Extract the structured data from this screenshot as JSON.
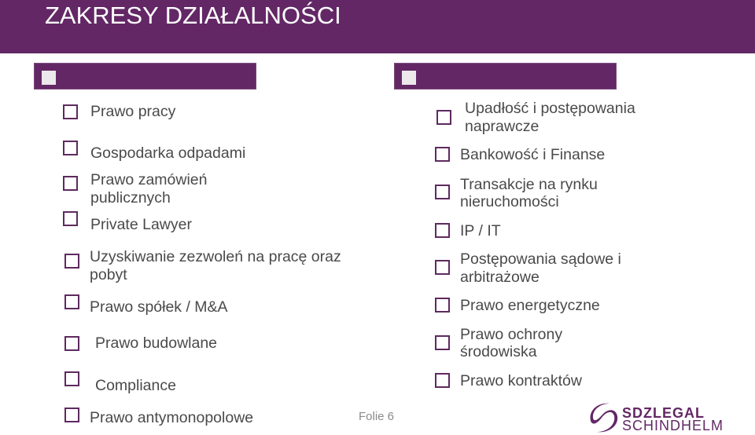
{
  "slide": {
    "title": "ZAKRESY DZIAŁALNOŚCI",
    "footer_label": "Folie 6",
    "colors": {
      "brand": "#632766",
      "text": "#4a4a4a",
      "checkbox_border": "#5e2a5f"
    }
  },
  "left_column": {
    "items": [
      {
        "label_line1": "Prawo pracy",
        "label_line2": ""
      },
      {
        "label_line1": "Gospodarka odpadami",
        "label_line2": ""
      },
      {
        "label_line1": "Prawo zamówień",
        "label_line2": "publicznych"
      },
      {
        "label_line1": "Private Lawyer",
        "label_line2": ""
      },
      {
        "label_line1": "Uzyskiwanie zezwoleń na pracę oraz",
        "label_line2": "pobyt"
      },
      {
        "label_line1": "Prawo spółek / M&A",
        "label_line2": ""
      },
      {
        "label_line1": "Prawo budowlane",
        "label_line2": ""
      },
      {
        "label_line1": "Compliance",
        "label_line2": ""
      },
      {
        "label_line1": "Prawo antymonopolowe",
        "label_line2": ""
      }
    ]
  },
  "right_column": {
    "items": [
      {
        "label_line1": "Upadłość i postępowania",
        "label_line2": "naprawcze"
      },
      {
        "label_line1": "Bankowość i Finanse",
        "label_line2": ""
      },
      {
        "label_line1": "Transakcje na rynku",
        "label_line2": "nieruchomości"
      },
      {
        "label_line1": "IP / IT",
        "label_line2": ""
      },
      {
        "label_line1": "Postępowania sądowe i",
        "label_line2": "arbitrażowe"
      },
      {
        "label_line1": "Prawo energetyczne",
        "label_line2": ""
      },
      {
        "label_line1": "Prawo ochrony",
        "label_line2": "środowiska"
      },
      {
        "label_line1": "Prawo kontraktów",
        "label_line2": ""
      }
    ]
  },
  "logo": {
    "line1": "SDZLEGAL",
    "line2": "SCHINDHELM",
    "icon": "s-swoosh-logo-icon"
  }
}
